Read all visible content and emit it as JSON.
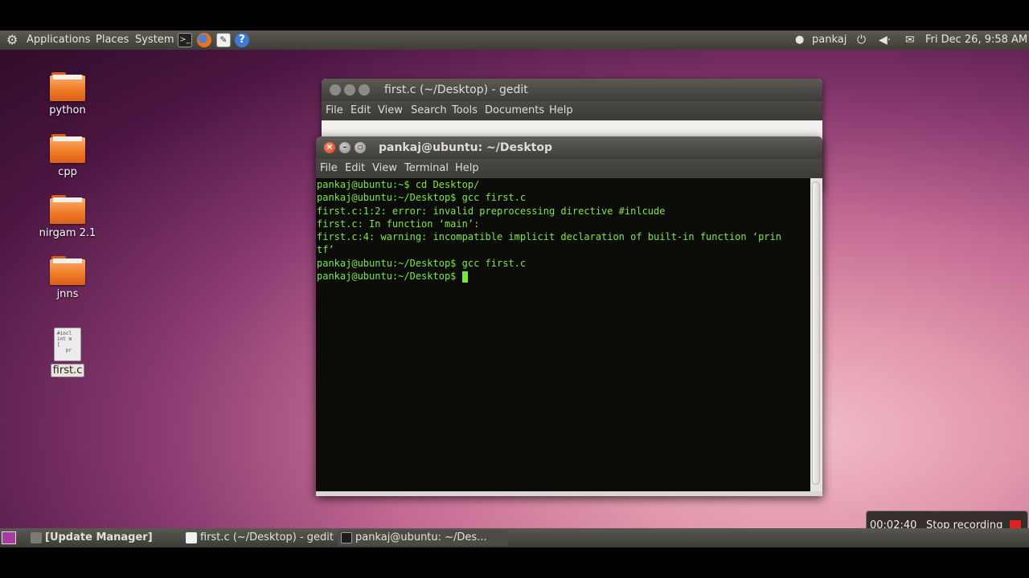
{
  "top_panel": {
    "menus": [
      "Applications",
      "Places",
      "System"
    ],
    "user": "pankaj",
    "datetime": "Fri Dec 26,  9:58 AM"
  },
  "desktop_icons": [
    {
      "label": "python",
      "type": "folder"
    },
    {
      "label": "cpp",
      "type": "folder"
    },
    {
      "label": "nirgam 2.1",
      "type": "folder"
    },
    {
      "label": "jnns",
      "type": "folder"
    },
    {
      "label": "first.c",
      "type": "file",
      "preview": "#incl\nint m\n{\n   pr"
    }
  ],
  "gedit": {
    "title": "first.c (~/Desktop) - gedit",
    "menu": [
      "File",
      "Edit",
      "View",
      "Search",
      "Tools",
      "Documents",
      "Help"
    ]
  },
  "terminal": {
    "title": "pankaj@ubuntu: ~/Desktop",
    "menu": [
      "File",
      "Edit",
      "View",
      "Terminal",
      "Help"
    ],
    "lines": [
      "pankaj@ubuntu:~$ cd Desktop/",
      "pankaj@ubuntu:~/Desktop$ gcc first.c",
      "first.c:1:2: error: invalid preprocessing directive #inlcude",
      "first.c: In function ‘main’:",
      "first.c:4: warning: incompatible implicit declaration of built-in function ‘prin",
      "tf’",
      "pankaj@ubuntu:~/Desktop$ gcc first.c"
    ],
    "prompt": "pankaj@ubuntu:~/Desktop$ "
  },
  "recording": {
    "time": "00:02:40",
    "stop_label": "Stop recording"
  },
  "taskbar": [
    {
      "label": "[Update Manager]"
    },
    {
      "label": "first.c (~/Desktop) - gedit"
    },
    {
      "label": "pankaj@ubuntu: ~/Des..."
    }
  ],
  "colors": {
    "terminal_text": "#7ee83a",
    "terminal_bg": "#0b0c08",
    "folder_orange": "#f07b25"
  }
}
